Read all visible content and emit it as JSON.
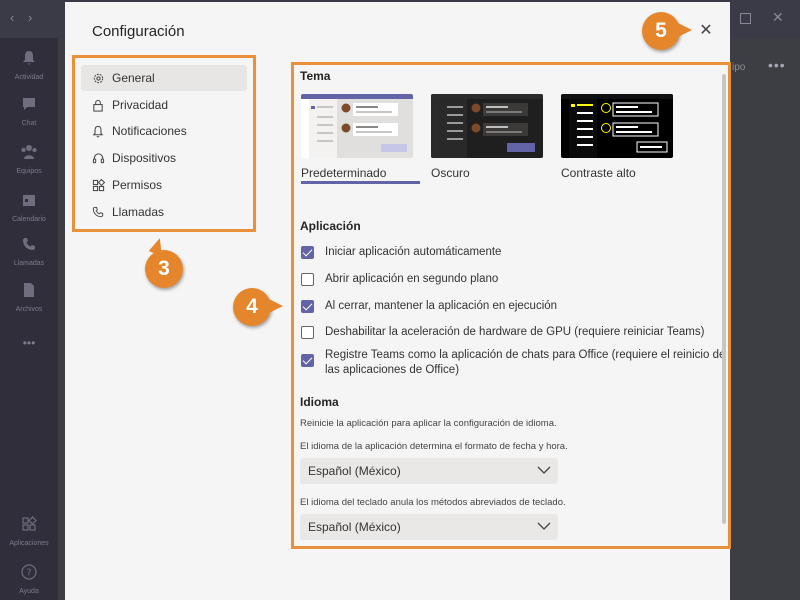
{
  "app": {
    "rail": [
      {
        "label": "Actividad",
        "icon": "bell-icon",
        "glyph": "🔔"
      },
      {
        "label": "Chat",
        "icon": "chat-icon",
        "glyph": "💬"
      },
      {
        "label": "Equipos",
        "icon": "teams-icon",
        "glyph": "👥"
      },
      {
        "label": "Calendario",
        "icon": "calendar-icon",
        "glyph": "📅"
      },
      {
        "label": "Llamadas",
        "icon": "phone-icon",
        "glyph": "📞"
      },
      {
        "label": "Archivos",
        "icon": "files-icon",
        "glyph": "📄"
      }
    ],
    "more_glyph": "•••",
    "bottom_rail": [
      {
        "label": "Aplicaciones",
        "icon": "apps-icon",
        "glyph": "⊞"
      },
      {
        "label": "Ayuda",
        "icon": "help-icon",
        "glyph": "?"
      }
    ],
    "partial_right_text": "ipo",
    "header_more": "•••"
  },
  "dialog": {
    "title": "Configuración",
    "close_glyph": "✕",
    "nav": [
      {
        "label": "General",
        "icon": "gear-icon",
        "active": true
      },
      {
        "label": "Privacidad",
        "icon": "lock-icon",
        "active": false
      },
      {
        "label": "Notificaciones",
        "icon": "bell-icon",
        "active": false
      },
      {
        "label": "Dispositivos",
        "icon": "headset-icon",
        "active": false
      },
      {
        "label": "Permisos",
        "icon": "apps-icon",
        "active": false
      },
      {
        "label": "Llamadas",
        "icon": "phone-icon",
        "active": false
      }
    ],
    "theme": {
      "heading": "Tema",
      "options": [
        {
          "label": "Predeterminado",
          "selected": true
        },
        {
          "label": "Oscuro",
          "selected": false
        },
        {
          "label": "Contraste alto",
          "selected": false
        }
      ]
    },
    "application": {
      "heading": "Aplicación",
      "options": [
        {
          "label": "Iniciar aplicación automáticamente",
          "checked": true
        },
        {
          "label": "Abrir aplicación en segundo plano",
          "checked": false
        },
        {
          "label": "Al cerrar, mantener la aplicación en ejecución",
          "checked": true
        },
        {
          "label": "Deshabilitar la aceleración de hardware de GPU (requiere reiniciar Teams)",
          "checked": false
        },
        {
          "label": "Registre Teams como la aplicación de chats para Office (requiere el reinicio de las aplicaciones de Office)",
          "checked": true
        }
      ]
    },
    "language": {
      "heading": "Idioma",
      "restart_note": "Reinicie la aplicación para aplicar la configuración de idioma.",
      "app_lang_note": "El idioma de la aplicación determina el formato de fecha y hora.",
      "app_lang_value": "Español (México)",
      "keyboard_note": "El idioma del teclado anula los métodos abreviados de teclado.",
      "keyboard_lang_value": "Español (México)"
    }
  },
  "annotations": {
    "badge_3": "3",
    "badge_4": "4",
    "badge_5": "5",
    "color": "#e8903a"
  },
  "colors": {
    "accent": "#6264a7",
    "dialog_bg": "#f5f5f5",
    "app_bg": "#3d3d44"
  }
}
